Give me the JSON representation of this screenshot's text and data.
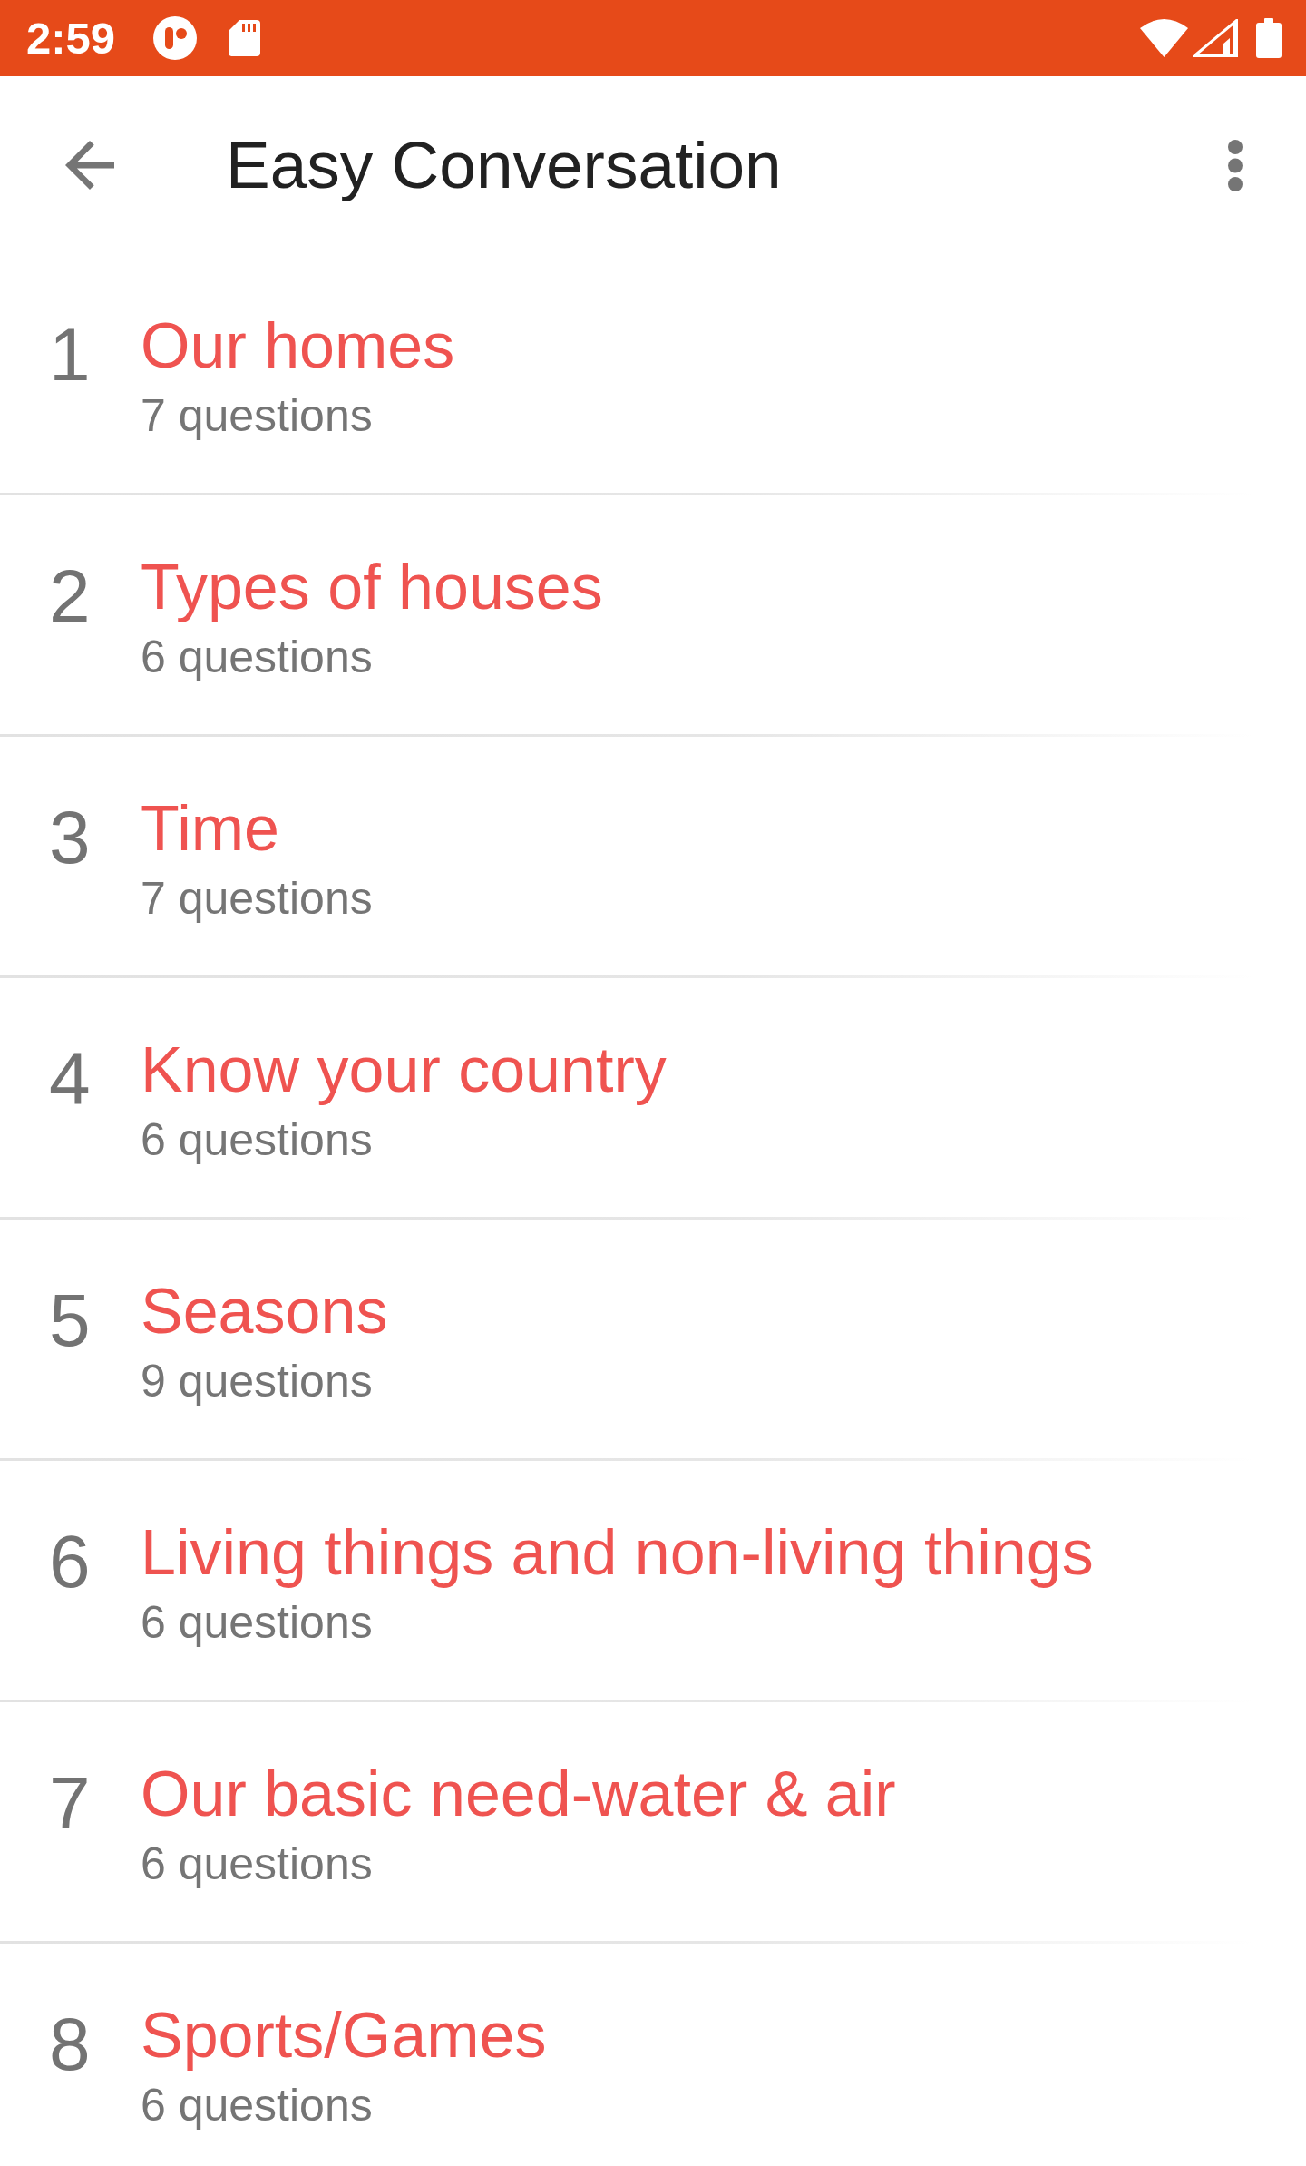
{
  "status_bar": {
    "time": "2:59"
  },
  "app_bar": {
    "title": "Easy Conversation"
  },
  "lessons": [
    {
      "number": "1",
      "title": "Our homes",
      "subtitle": "7 questions"
    },
    {
      "number": "2",
      "title": "Types of houses",
      "subtitle": "6 questions"
    },
    {
      "number": "3",
      "title": "Time",
      "subtitle": "7 questions"
    },
    {
      "number": "4",
      "title": "Know your country",
      "subtitle": "6 questions"
    },
    {
      "number": "5",
      "title": "Seasons",
      "subtitle": "9 questions"
    },
    {
      "number": "6",
      "title": "Living things and non-living things",
      "subtitle": "6 questions"
    },
    {
      "number": "7",
      "title": "Our basic need-water & air",
      "subtitle": "6 questions"
    },
    {
      "number": "8",
      "title": "Sports/Games",
      "subtitle": "6 questions"
    }
  ]
}
